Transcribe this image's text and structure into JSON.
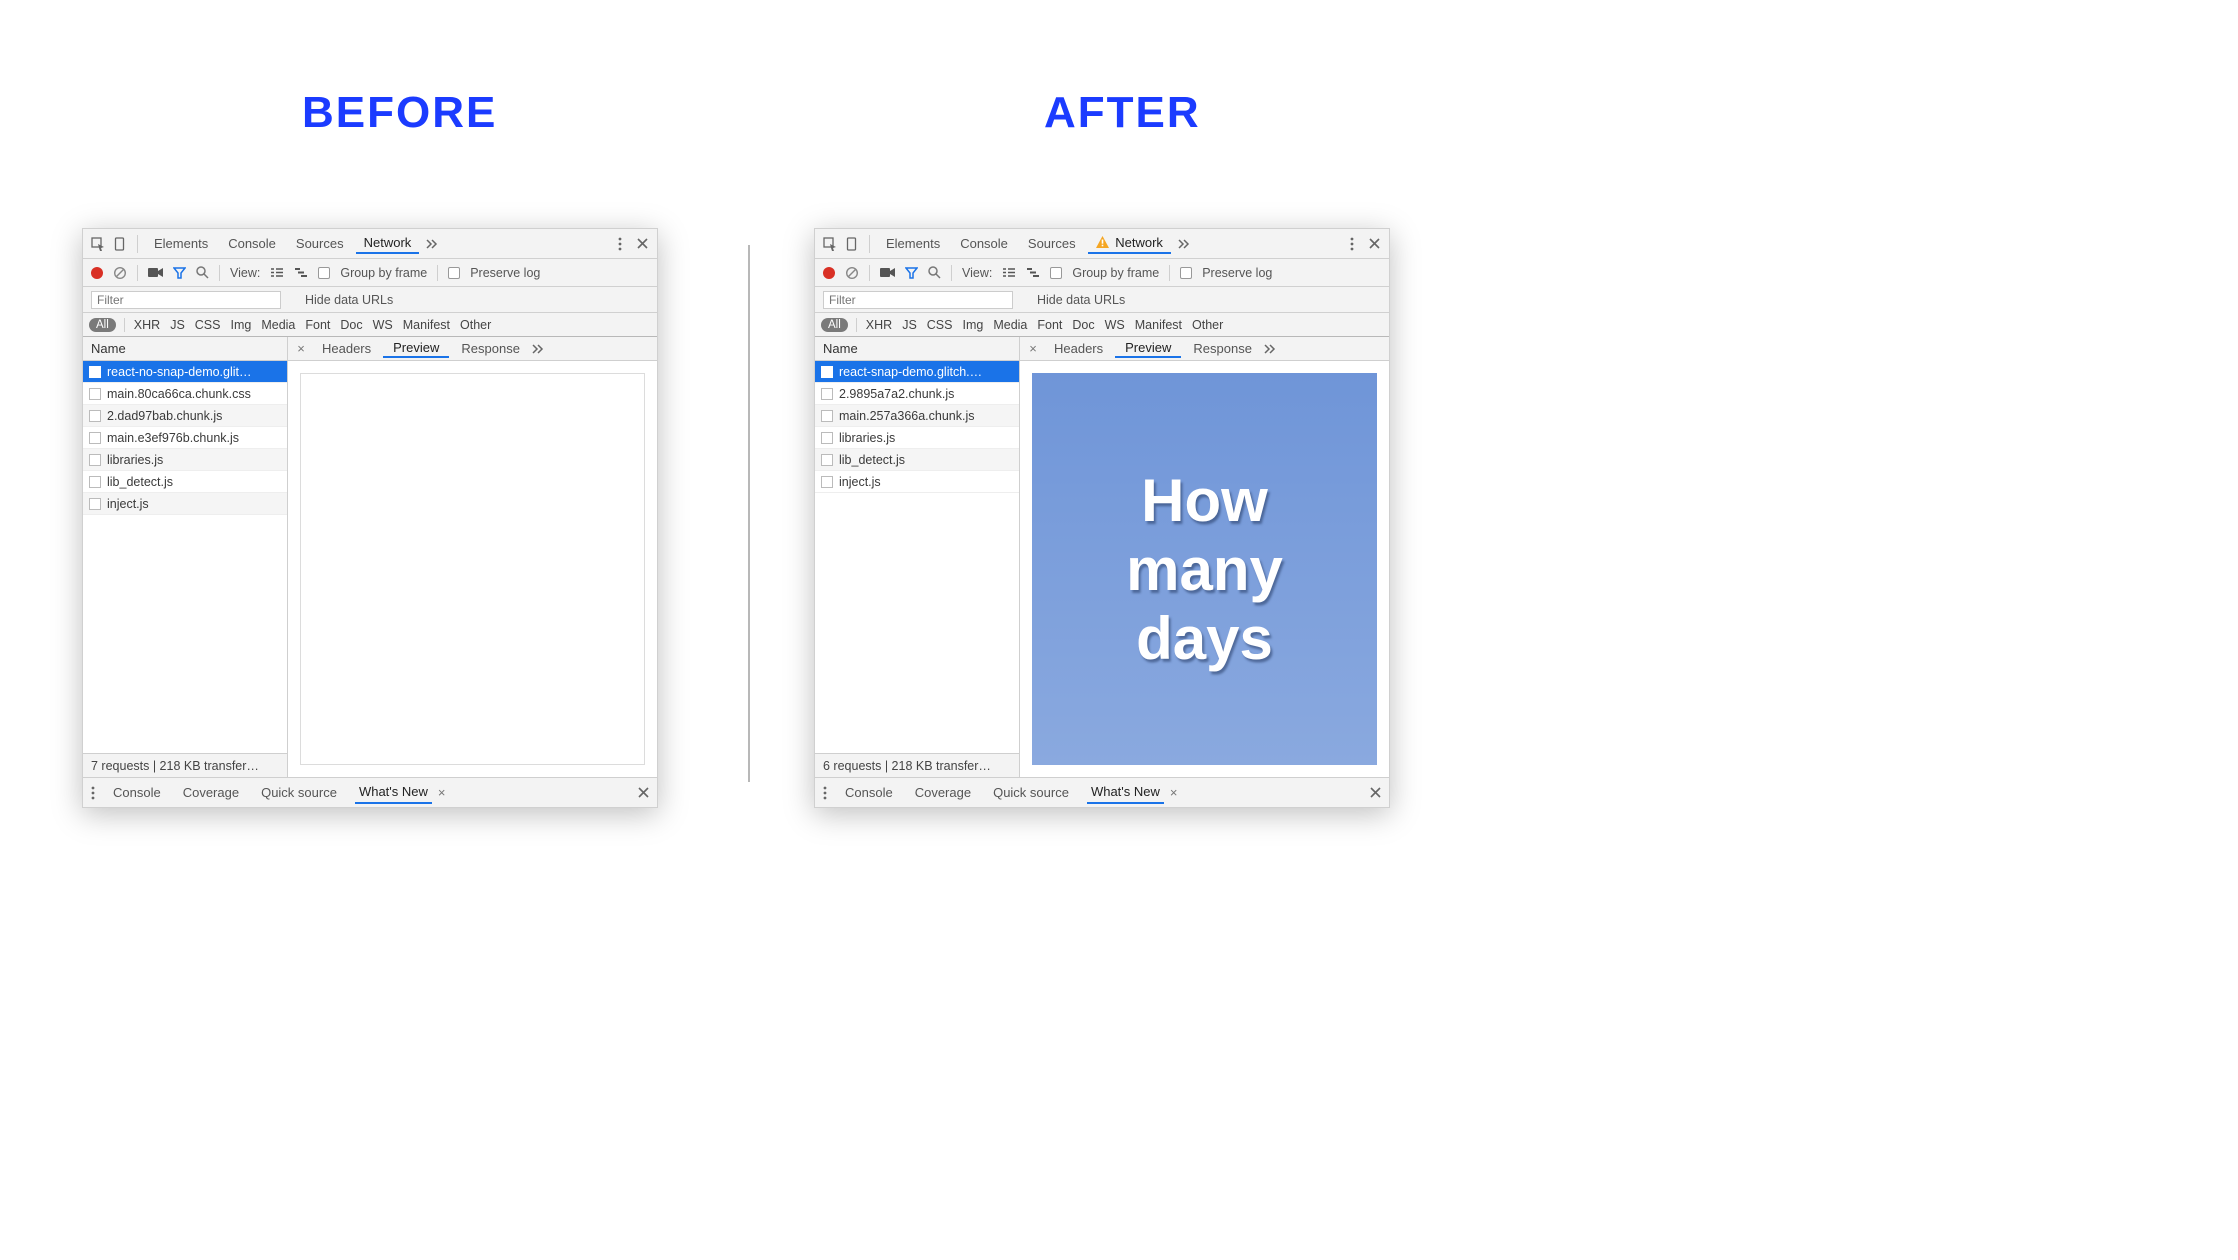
{
  "headings": {
    "before": "BEFORE",
    "after": "AFTER"
  },
  "tabs": {
    "elements": "Elements",
    "console": "Console",
    "sources": "Sources",
    "network": "Network"
  },
  "toolbar": {
    "view": "View:",
    "group_by_frame": "Group by frame",
    "preserve_log": "Preserve log"
  },
  "filter": {
    "placeholder": "Filter",
    "hide_data_urls": "Hide data URLs"
  },
  "types": {
    "all": "All",
    "xhr": "XHR",
    "js": "JS",
    "css": "CSS",
    "img": "Img",
    "media": "Media",
    "font": "Font",
    "doc": "Doc",
    "ws": "WS",
    "manifest": "Manifest",
    "other": "Other"
  },
  "list_header": "Name",
  "detail_tabs": {
    "headers": "Headers",
    "preview": "Preview",
    "response": "Response"
  },
  "drawer": {
    "console": "Console",
    "coverage": "Coverage",
    "quick_source": "Quick source",
    "whats_new": "What's New"
  },
  "before": {
    "requests": [
      "react-no-snap-demo.glit…",
      "main.80ca66ca.chunk.css",
      "2.dad97bab.chunk.js",
      "main.e3ef976b.chunk.js",
      "libraries.js",
      "lib_detect.js",
      "inject.js"
    ],
    "status": "7 requests | 218 KB transfer…",
    "has_warning": false,
    "preview_text": [
      "",
      "",
      ""
    ]
  },
  "after": {
    "requests": [
      "react-snap-demo.glitch.…",
      "2.9895a7a2.chunk.js",
      "main.257a366a.chunk.js",
      "libraries.js",
      "lib_detect.js",
      "inject.js"
    ],
    "status": "6 requests | 218 KB transfer…",
    "has_warning": true,
    "preview_text": [
      "How",
      "many",
      "days"
    ]
  }
}
